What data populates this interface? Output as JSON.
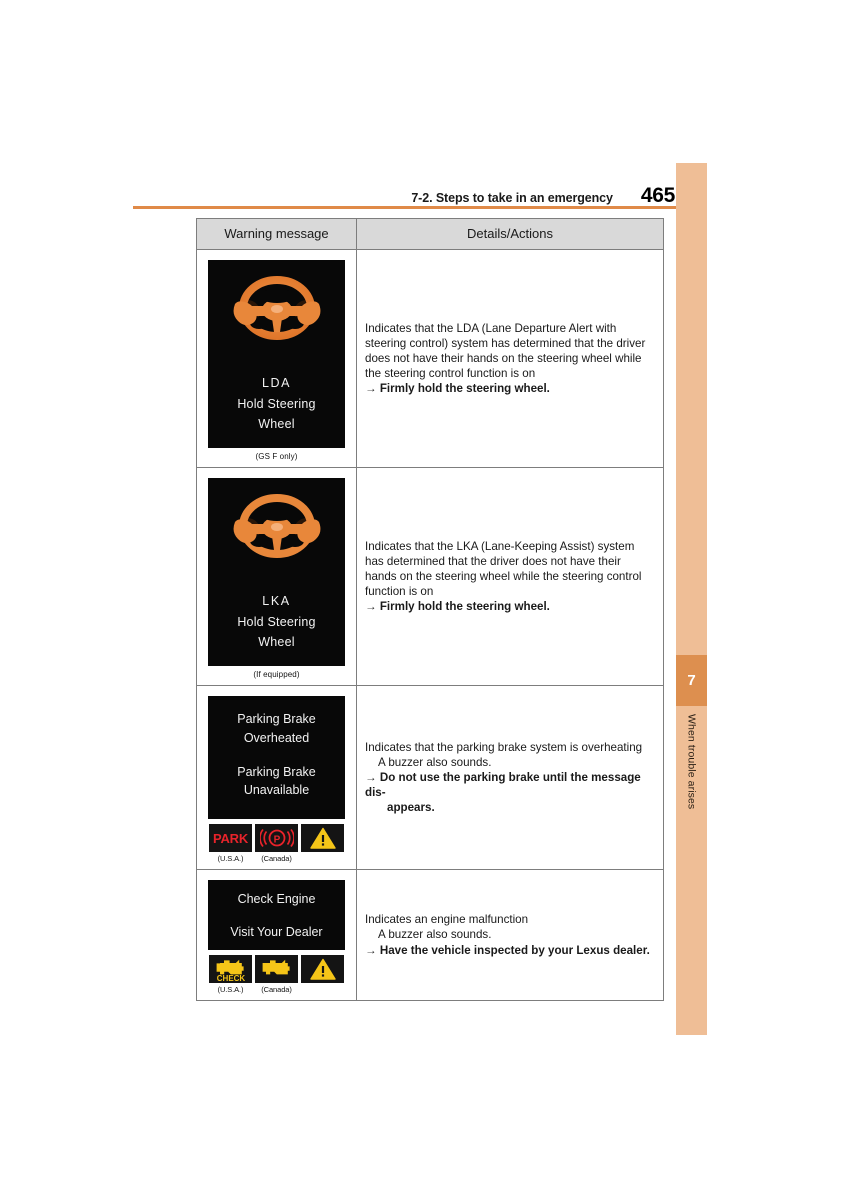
{
  "header": {
    "section_title": "7-2. Steps to take in an emergency",
    "page_number": "465"
  },
  "sidebar": {
    "chapter_number": "7",
    "chapter_label": "When trouble arises",
    "strip_color": "#efbe96",
    "tab_color": "#dd8f4f",
    "rule_color": "#e08a48"
  },
  "table": {
    "columns": [
      {
        "header": "Warning message"
      },
      {
        "header": "Details/Actions"
      }
    ],
    "rows": [
      {
        "id": "lda-hold-steering-wheel",
        "display": {
          "icon": "steering-wheel-hands-icon",
          "lines": [
            "LDA",
            "Hold Steering",
            "Wheel"
          ]
        },
        "caption": "(GS F only)",
        "details": {
          "body": "Indicates that the LDA (Lane Departure Alert with steering control) system has determined that the driver does not have their hands on the steering wheel while the steering control function is on",
          "action_arrow": "→",
          "action": "Firmly hold the steering wheel."
        }
      },
      {
        "id": "lka-hold-steering-wheel",
        "display": {
          "icon": "steering-wheel-hands-icon",
          "lines": [
            "LKA",
            "Hold Steering",
            "Wheel"
          ]
        },
        "caption": "(If equipped)",
        "details": {
          "body": "Indicates that the LKA (Lane-Keeping Assist) system has determined that the driver does not have their hands on the steering wheel while the steering control function is on",
          "action_arrow": "→",
          "action": "Firmly hold the steering wheel."
        }
      },
      {
        "id": "parking-brake-overheated",
        "display": {
          "lines_top": [
            "Parking Brake",
            "Overheated"
          ],
          "lines_bottom": [
            "Parking Brake",
            "Unavailable"
          ]
        },
        "indicators": [
          {
            "icon": "park-text-indicator",
            "text": "PARK",
            "color": "#e8232a",
            "caption": "(U.S.A.)"
          },
          {
            "icon": "parking-brake-p-circle-icon",
            "color": "#e8232a",
            "caption": "(Canada)"
          },
          {
            "icon": "master-warning-triangle-icon",
            "color": "#f5c518",
            "caption": ""
          }
        ],
        "details": {
          "body": "Indicates that the parking brake system is overheating",
          "sub": "A buzzer also sounds.",
          "action_arrow": "→",
          "action": "Do not use the parking brake until the message dis-",
          "action_cont": "appears."
        }
      },
      {
        "id": "check-engine-visit-dealer",
        "display": {
          "lines_top": [
            "Check Engine"
          ],
          "lines_bottom": [
            "Visit Your Dealer"
          ]
        },
        "indicators": [
          {
            "icon": "check-engine-usa-icon",
            "text": "CHECK",
            "color": "#f5c518",
            "caption": "(U.S.A.)"
          },
          {
            "icon": "check-engine-canada-icon",
            "color": "#f5c518",
            "caption": "(Canada)"
          },
          {
            "icon": "master-warning-triangle-icon",
            "color": "#f5c518",
            "caption": ""
          }
        ],
        "details": {
          "body": "Indicates an engine malfunction",
          "sub": "A buzzer also sounds.",
          "action_arrow": "→",
          "action": "Have the vehicle inspected by your Lexus dealer."
        }
      }
    ]
  }
}
